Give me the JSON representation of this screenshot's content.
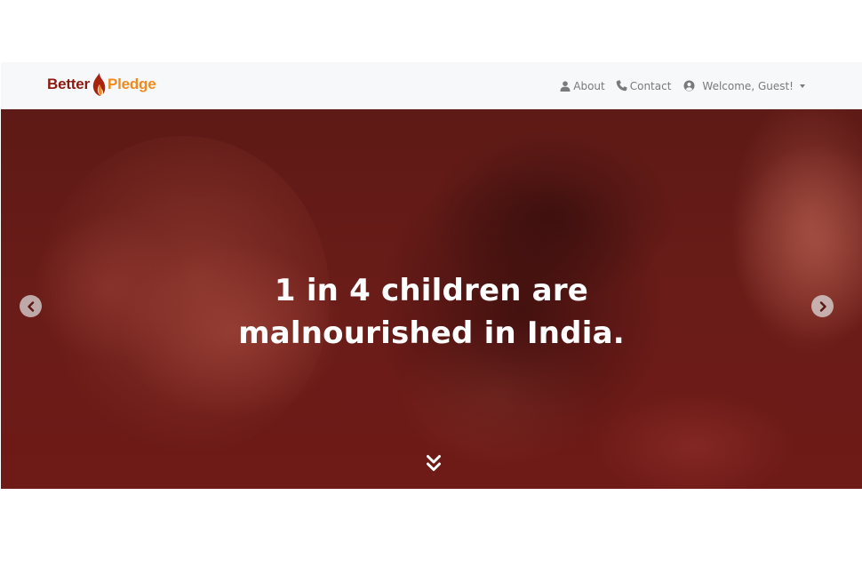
{
  "navbar": {
    "brand": {
      "word1": "Better",
      "word2": "Pledge",
      "logo_icon": "flame-icon",
      "colors": {
        "word1": "#8b1a10",
        "word2": "#f08a1c"
      }
    },
    "links": [
      {
        "label": "About",
        "icon": "user-icon"
      },
      {
        "label": "Contact",
        "icon": "phone-icon"
      },
      {
        "label": "Welcome, Guest!",
        "icon": "user-circle-icon",
        "has_dropdown": true
      }
    ]
  },
  "hero": {
    "headline_line1": "1 in 4 children are",
    "headline_line2": "malnourished in India.",
    "overlay_color": "#6a1c18",
    "prev_icon": "chevron-left-icon",
    "next_icon": "chevron-right-icon",
    "scroll_icon": "double-chevron-down-icon"
  }
}
